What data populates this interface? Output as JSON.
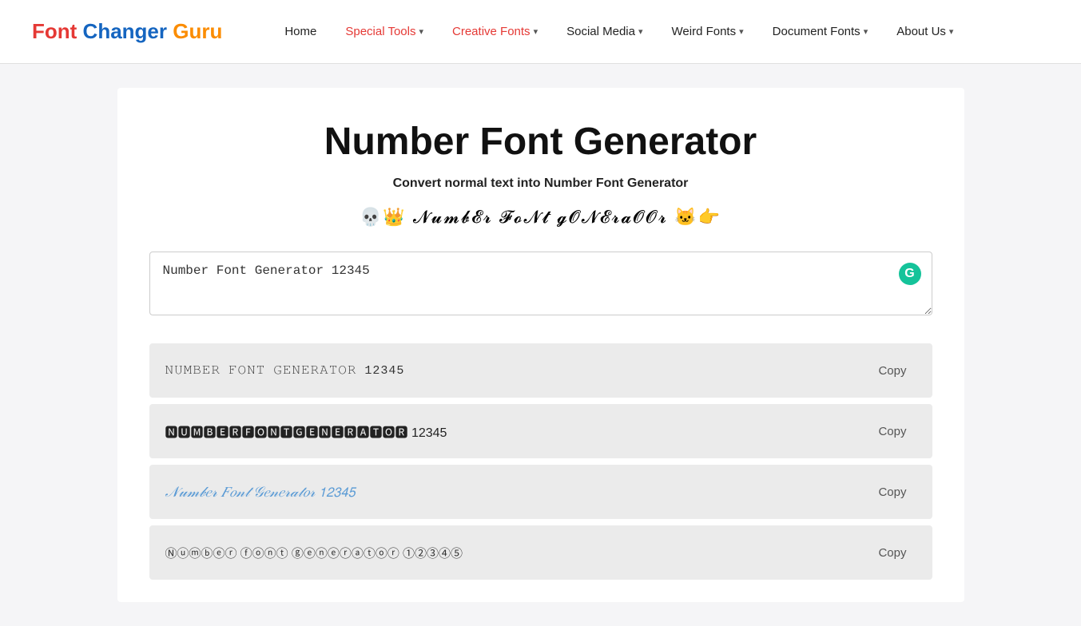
{
  "logo": {
    "font": "Font",
    "changer": " Changer",
    "guru": " Guru"
  },
  "nav": {
    "items": [
      {
        "id": "home",
        "label": "Home",
        "hasDropdown": false,
        "active": false
      },
      {
        "id": "special-tools",
        "label": "Special Tools",
        "hasDropdown": true,
        "active": true
      },
      {
        "id": "creative-fonts",
        "label": "Creative Fonts",
        "hasDropdown": true,
        "active": false,
        "creative": true
      },
      {
        "id": "social-media",
        "label": "Social Media",
        "hasDropdown": true,
        "active": false
      },
      {
        "id": "weird-fonts",
        "label": "Weird Fonts",
        "hasDropdown": true,
        "active": false
      },
      {
        "id": "document-fonts",
        "label": "Document Fonts",
        "hasDropdown": true,
        "active": false
      },
      {
        "id": "about-us",
        "label": "About Us",
        "hasDropdown": true,
        "active": false
      }
    ]
  },
  "page": {
    "title": "Number Font Generator",
    "subtitle": "Convert normal text into Number Font Generator",
    "decorative": "💀👑 𝓝𝓾𝓶𝓫𝓔𝓻 𝓕𝓸𝓝𝓽 𝓰𝓞𝓝𝓔𝓻𝓪𝓞𝓞𝓻 🐱👉"
  },
  "input": {
    "value": "Number Font Generator 12345",
    "placeholder": "Number Font Generator 12345"
  },
  "results": [
    {
      "id": "result-1",
      "text": "𝙽𝚄𝙼𝙱𝙴𝚁 𝙵𝙾𝙽𝚃 𝙶𝙴𝙽𝙴𝚁𝙰𝚃𝙾𝚁 12345",
      "copyLabel": "Copy",
      "style": "typewriter"
    },
    {
      "id": "result-2",
      "text": "🅽🆄🅼🅱🅴🆁🅵🅾🅽🆃🅶🅴🅽🅴🆁🅰🆃🅾🆁 12345",
      "copyLabel": "Copy",
      "style": "block"
    },
    {
      "id": "result-3",
      "text": "𝒩𝓊𝓂𝒷𝑒𝓇 𝐹𝑜𝓃𝓉 𝒢𝑒𝓃𝑒𝓇𝒶𝓉𝑜𝓇 𝟣𝟤𝟥𝟦𝟧",
      "copyLabel": "Copy",
      "style": "cursive"
    },
    {
      "id": "result-4",
      "text": "Ⓝⓤⓜⓑⓔⓡ ⓕⓞⓝⓣ ⓖⓔⓝⓔⓡⓐⓣⓞⓡ ①②③④⑤",
      "copyLabel": "Copy",
      "style": "circle"
    }
  ],
  "grammarly": {
    "label": "G"
  }
}
